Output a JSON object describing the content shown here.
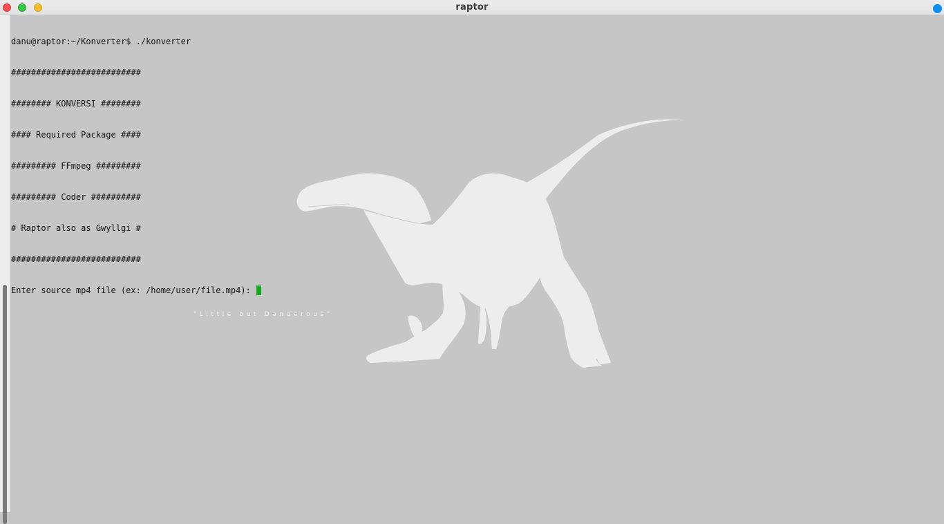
{
  "window": {
    "title": "raptor"
  },
  "terminal": {
    "lines": [
      "danu@raptor:~/Konverter$ ./konverter",
      "##########################",
      "######## KONVERSI ########",
      "#### Required Package ####",
      "######### FFmpeg #########",
      "######### Coder ##########",
      "# Raptor also as Gwyllgi #",
      "##########################"
    ],
    "prompt": "Enter source mp4 file (ex: /home/user/file.mp4): ",
    "cursor_color": "#18a61f"
  },
  "wallpaper": {
    "tagline": "\"Little but Dangerous\"",
    "image": "raptor-silhouette"
  },
  "colors": {
    "background": "#c6c6c6",
    "silhouette": "#ededed",
    "close": "#f25056",
    "maximize": "#39c348",
    "minimize": "#f7be2f",
    "accent_dot": "#0e8ff0"
  }
}
